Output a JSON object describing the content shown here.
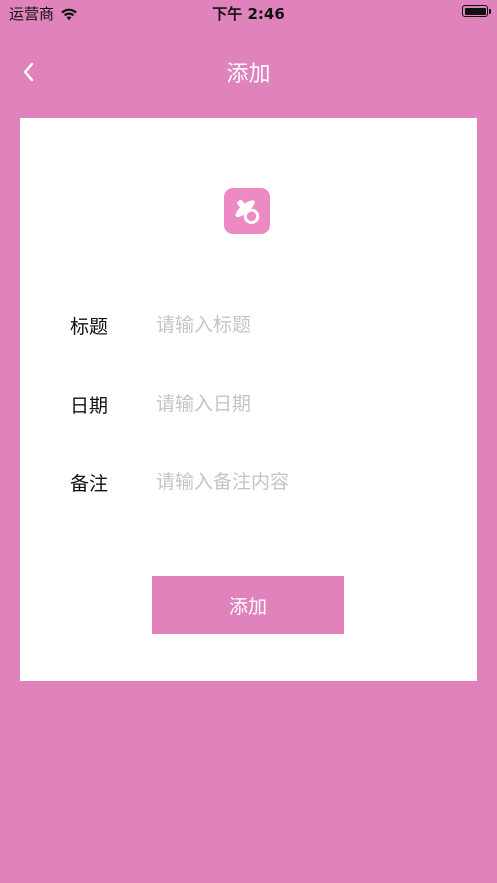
{
  "status_bar": {
    "carrier": "运营商",
    "time": "下午 2:46"
  },
  "nav": {
    "title": "添加",
    "back_icon": "chevron-left-icon"
  },
  "app_icon": "pacifier-icon",
  "form": {
    "title_label": "标题",
    "title_placeholder": "请输入标题",
    "date_label": "日期",
    "date_placeholder": "请输入日期",
    "note_label": "备注",
    "note_placeholder": "请输入备注内容"
  },
  "submit_label": "添加",
  "colors": {
    "background": "#E082BB",
    "card": "#FFFFFF",
    "icon_bg": "#EE8AC3",
    "placeholder": "#C4C4C4"
  }
}
